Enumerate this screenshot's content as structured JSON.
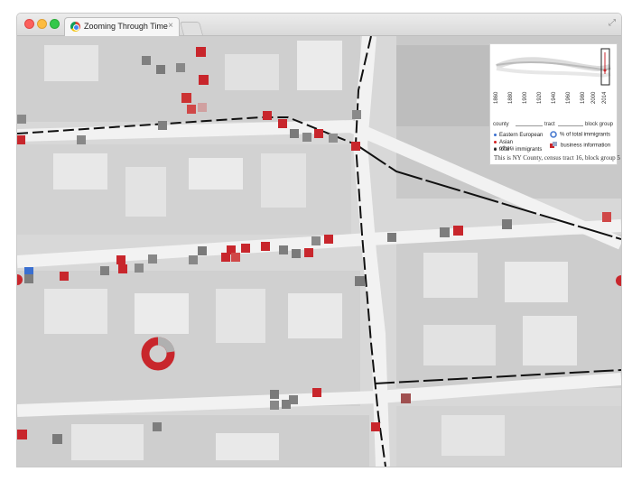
{
  "browser": {
    "tab_title": "Zooming Through Time",
    "tab_close": "×"
  },
  "colors": {
    "eastern_european": "#d42020",
    "asian": "#e05050",
    "other": "#777777",
    "total": "#333333",
    "map_background": "#d6d6d6"
  },
  "legend": {
    "years": [
      "1860",
      "1880",
      "1900",
      "1920",
      "1940",
      "1960",
      "1980",
      "2000",
      "2014"
    ],
    "levels": [
      "county",
      "tract",
      "block group"
    ],
    "items": [
      {
        "label": "Eastern European",
        "color": "#3a6fd0"
      },
      {
        "label": "Asian",
        "color": "#d42020"
      },
      {
        "label": "other",
        "color": "#999999"
      },
      {
        "label": "total # immigrants",
        "color": "#222222"
      }
    ],
    "ring_label": "% of total immigrants",
    "business_label": "business information",
    "caption": "This is NY County, census tract 16, block group 5"
  }
}
